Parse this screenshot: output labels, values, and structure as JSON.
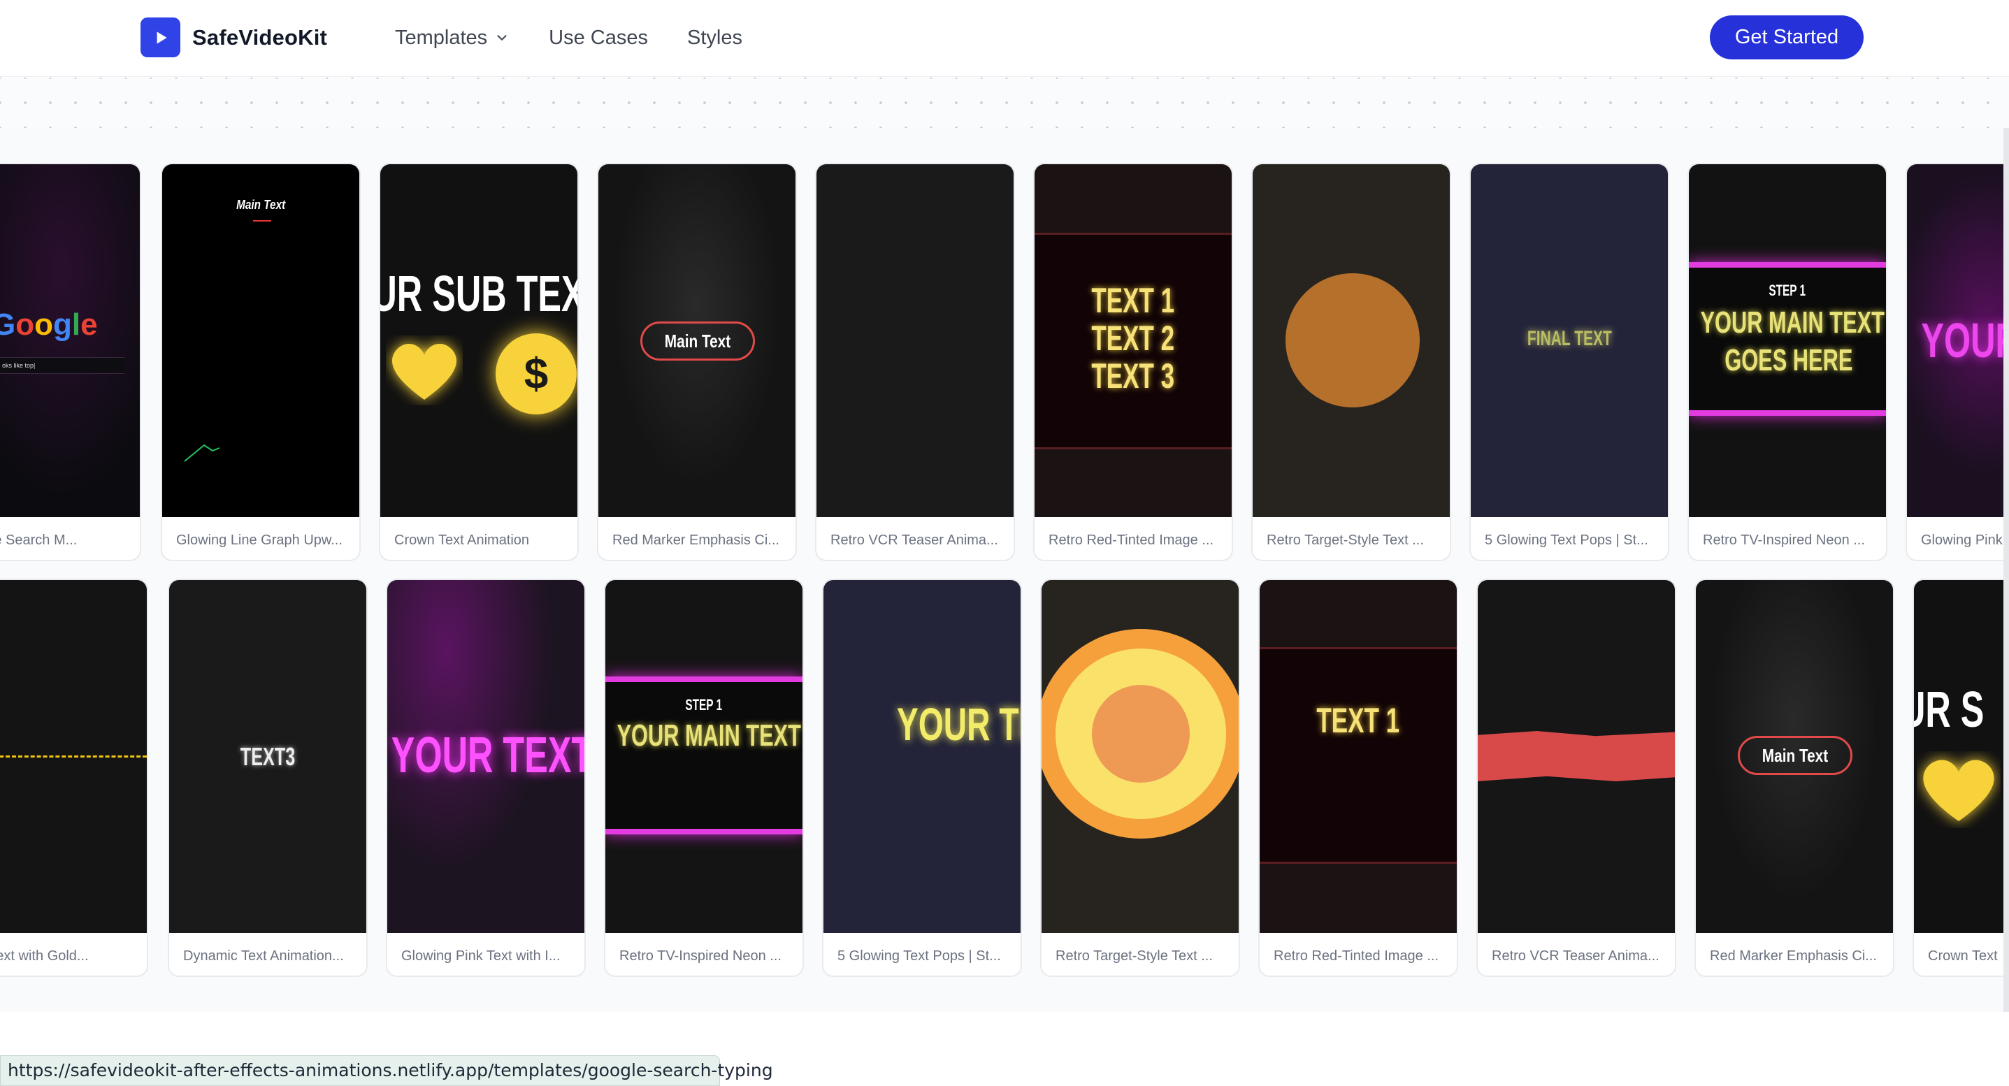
{
  "header": {
    "brand": "SafeVideoKit",
    "nav": [
      {
        "label": "Templates",
        "has_dropdown": true
      },
      {
        "label": "Use Cases"
      },
      {
        "label": "Styles"
      }
    ],
    "cta_label": "Get Started",
    "accent_color": "#2631d9",
    "icons": {
      "logo": "play-icon",
      "dropdown": "chevron-down-icon"
    }
  },
  "row1": [
    {
      "caption": "Google Search M...",
      "thumb_text": "Google",
      "thumb_sub": "oks like top|"
    },
    {
      "caption": "Glowing Line Graph Upw...",
      "thumb_text": "Main Text"
    },
    {
      "caption": "Crown Text Animation",
      "thumb_text": "UR SUB TEX",
      "glyph": "$"
    },
    {
      "caption": "Red Marker Emphasis Ci...",
      "thumb_text": "Main Text"
    },
    {
      "caption": "Retro VCR Teaser Anima..."
    },
    {
      "caption": "Retro Red-Tinted Image ...",
      "lines": [
        "TEXT 1",
        "TEXT 2",
        "TEXT 3"
      ]
    },
    {
      "caption": "Retro Target-Style Text ..."
    },
    {
      "caption": "5 Glowing Text Pops | St...",
      "thumb_text": "FINAL TEXT"
    },
    {
      "caption": "Retro TV-Inspired Neon ...",
      "thumb_sub": "STEP 1",
      "lines": [
        "YOUR MAIN TEXT",
        "GOES HERE"
      ]
    },
    {
      "caption": "Glowing Pink",
      "thumb_text": "YOUR"
    }
  ],
  "row2": [
    {
      "caption": "mic Text with Gold..."
    },
    {
      "caption": "Dynamic Text Animation...",
      "thumb_text": "TEXT3"
    },
    {
      "caption": "Glowing Pink Text with I...",
      "thumb_text": "YOUR TEXT"
    },
    {
      "caption": "Retro TV-Inspired Neon ...",
      "thumb_sub": "STEP 1",
      "thumb_text": "YOUR MAIN TEXT"
    },
    {
      "caption": "5 Glowing Text Pops | St...",
      "thumb_text": "YOUR TI"
    },
    {
      "caption": "Retro Target-Style Text ..."
    },
    {
      "caption": "Retro Red-Tinted Image ...",
      "thumb_text": "TEXT 1"
    },
    {
      "caption": "Retro VCR Teaser Anima..."
    },
    {
      "caption": "Red Marker Emphasis Ci...",
      "thumb_text": "Main Text"
    },
    {
      "caption": "Crown Text",
      "thumb_text": "UR S"
    }
  ],
  "status_url": "https://safevideokit-after-effects-animations.netlify.app/templates/google-search-typing"
}
